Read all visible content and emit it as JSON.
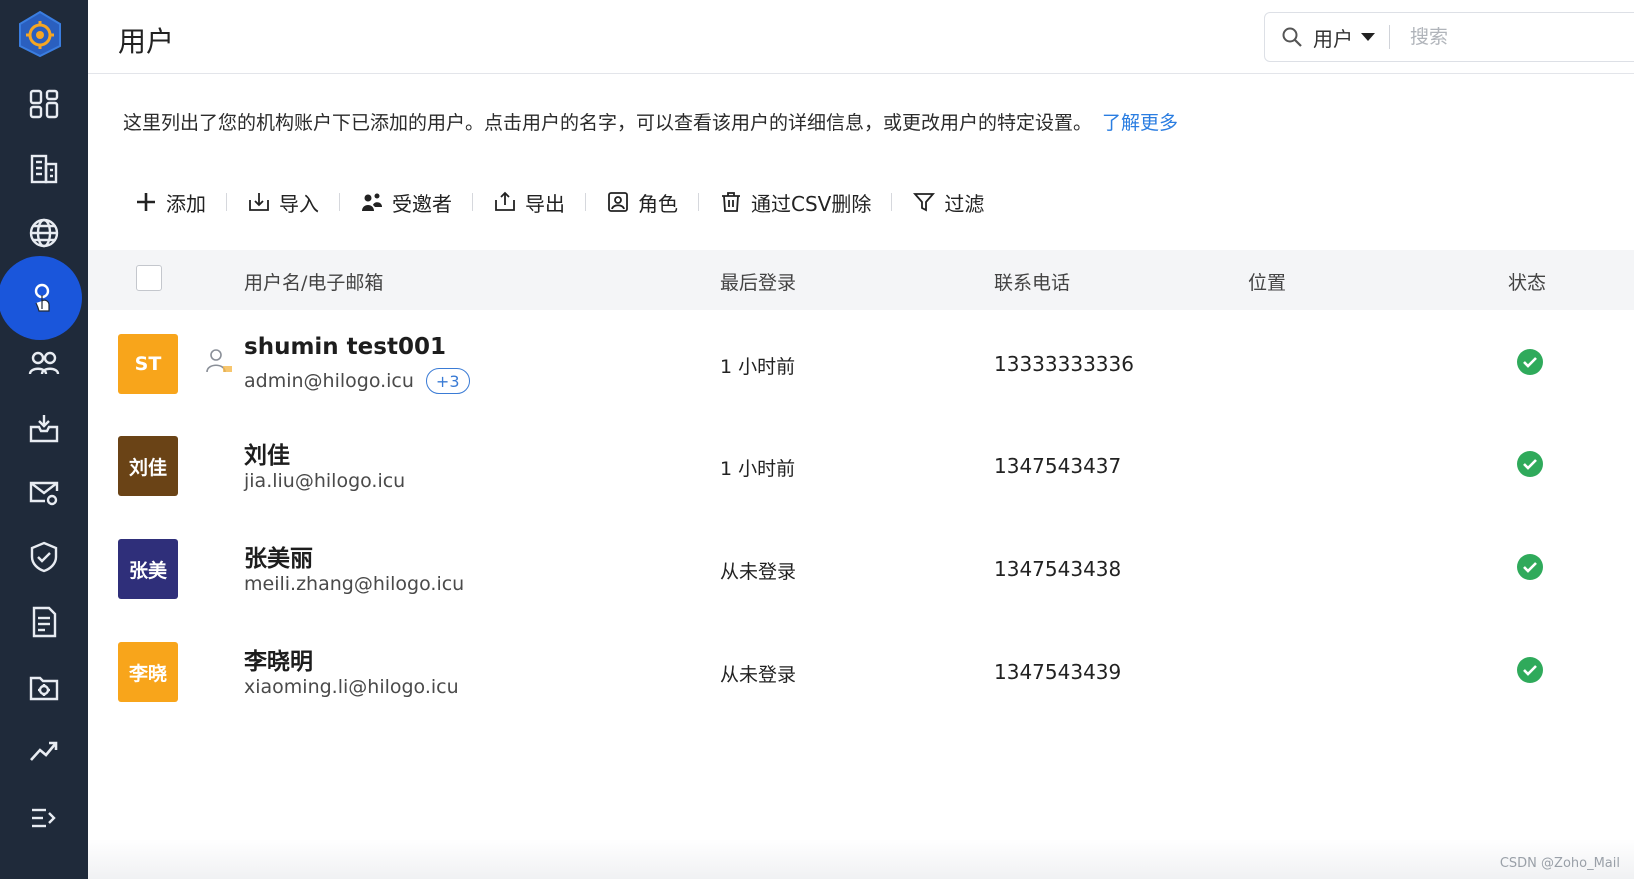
{
  "header": {
    "title": "用户",
    "search_scope": "用户",
    "search_placeholder": "搜索"
  },
  "description": {
    "text": "这里列出了您的机构账户下已添加的用户。点击用户的名字，可以查看该用户的详细信息，或更改用户的特定设置。",
    "link": "了解更多"
  },
  "toolbar": {
    "add": "添加",
    "import": "导入",
    "invitees": "受邀者",
    "export": "导出",
    "roles": "角色",
    "delete_csv": "通过CSV删除",
    "filter": "过滤"
  },
  "table": {
    "columns": {
      "name": "用户名/电子邮箱",
      "last_login": "最后登录",
      "phone": "联系电话",
      "location": "位置",
      "status": "状态"
    },
    "rows": [
      {
        "initials": "ST",
        "avatar_color": "#f8a51b",
        "name": "shumin test001",
        "email": "admin@hilogo.icu",
        "badge": "+3",
        "last_login": "1 小时前",
        "phone": "13333333336",
        "location": "",
        "status": "active",
        "is_admin": true
      },
      {
        "initials": "刘佳",
        "avatar_color": "#6a4316",
        "name": "刘佳",
        "email": "jia.liu@hilogo.icu",
        "badge": "",
        "last_login": "1 小时前",
        "phone": "1347543437",
        "location": "",
        "status": "active",
        "is_admin": false
      },
      {
        "initials": "张美",
        "avatar_color": "#2f2f7a",
        "name": "张美丽",
        "email": "meili.zhang@hilogo.icu",
        "badge": "",
        "last_login": "从未登录",
        "phone": "1347543438",
        "location": "",
        "status": "active",
        "is_admin": false
      },
      {
        "initials": "李晓",
        "avatar_color": "#f8a51b",
        "name": "李晓明",
        "email": "xiaoming.li@hilogo.icu",
        "badge": "",
        "last_login": "从未登录",
        "phone": "1347543439",
        "location": "",
        "status": "active",
        "is_admin": false
      }
    ]
  },
  "sidebar": {
    "items": [
      "dashboard-icon",
      "organization-icon",
      "domains-icon",
      "users-icon",
      "groups-icon",
      "mail-import-icon",
      "mail-settings-icon",
      "security-icon",
      "reports-icon",
      "storage-settings-icon",
      "analytics-icon",
      "menu-collapse-icon"
    ],
    "active_index": 3
  },
  "colors": {
    "sidebar_bg": "#1f2a3a",
    "active_item": "#1a56db",
    "link": "#2a7de1",
    "status_ok": "#2faa5b"
  },
  "watermark": "CSDN @Zoho_Mail"
}
